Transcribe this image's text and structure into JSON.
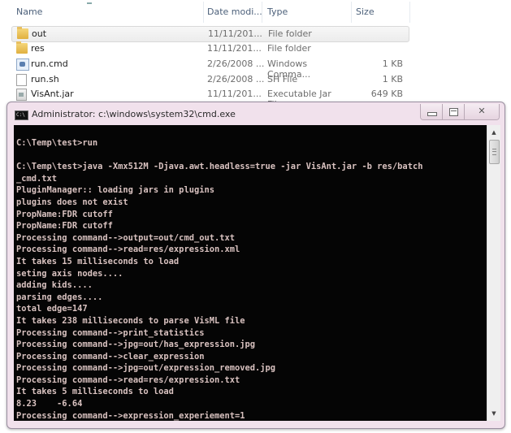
{
  "explorer": {
    "columns": {
      "name": "Name",
      "date": "Date modi...",
      "type": "Type",
      "size": "Size"
    },
    "files": [
      {
        "name": "out",
        "date": "11/11/201...",
        "type": "File folder",
        "size": "",
        "icon": "folder-icon",
        "selected": true
      },
      {
        "name": "res",
        "date": "11/11/201...",
        "type": "File folder",
        "size": "",
        "icon": "folder-icon",
        "selected": false
      },
      {
        "name": "run.cmd",
        "date": "2/26/2008 ...",
        "type": "Windows Comma...",
        "size": "1 KB",
        "icon": "cmd-file-icon",
        "selected": false
      },
      {
        "name": "run.sh",
        "date": "2/26/2008 ...",
        "type": "SH File",
        "size": "1 KB",
        "icon": "document-icon",
        "selected": false
      },
      {
        "name": "VisAnt.jar",
        "date": "11/11/201...",
        "type": "Executable Jar File",
        "size": "649 KB",
        "icon": "jar-file-icon",
        "selected": false
      }
    ]
  },
  "console": {
    "title": "Administrator: c:\\windows\\system32\\cmd.exe",
    "icon_label": "C:\\",
    "controls": {
      "minimize": "minimize",
      "maximize": "maximize",
      "close": "close"
    },
    "scroll_up": "▲",
    "scroll_down": "▼",
    "lines": [
      "C:\\Temp\\test>run",
      "",
      "C:\\Temp\\test>java -Xmx512M -Djava.awt.headless=true -jar VisAnt.jar -b res/batch",
      "_cmd.txt",
      "PluginManager:: loading jars in plugins",
      "plugins does not exist",
      "PropName:FDR cutoff",
      "PropName:FDR cutoff",
      "Processing command-->output=out/cmd_out.txt",
      "Processing command-->read=res/expression.xml",
      "It takes 15 milliseconds to load",
      "seting axis nodes....",
      "adding kids....",
      "parsing edges....",
      "total edge=147",
      "It takes 238 milliseconds to parse VisML file",
      "Processing command-->print_statistics",
      "Processing command-->jpg=out/has_expression.jpg",
      "Processing command-->clear_expression",
      "Processing command-->jpg=out/expression_removed.jpg",
      "Processing command-->read=res/expression.txt",
      "It takes 5 milliseconds to load",
      "8.23    -6.64",
      "Processing command-->expression_experiement=1"
    ]
  }
}
